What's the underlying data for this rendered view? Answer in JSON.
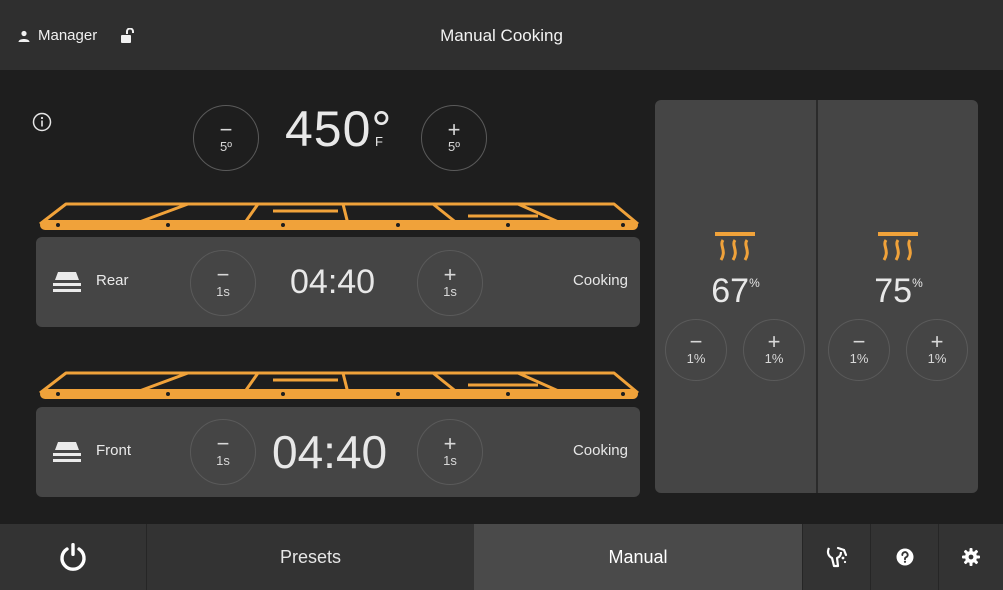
{
  "header": {
    "user_name": "Manager",
    "title": "Manual Cooking"
  },
  "temperature": {
    "value": "450°",
    "unit": "F",
    "step_down": "5º",
    "step_up": "5º"
  },
  "zones": [
    {
      "name": "Rear",
      "time": "04:40",
      "status": "Cooking",
      "step_down": "1s",
      "step_up": "1s"
    },
    {
      "name": "Front",
      "time": "04:40",
      "status": "Cooking",
      "step_down": "1s",
      "step_up": "1s"
    }
  ],
  "heaters": [
    {
      "value": "67",
      "unit": "%",
      "step_down": "1%",
      "step_up": "1%"
    },
    {
      "value": "75",
      "unit": "%",
      "step_down": "1%",
      "step_up": "1%"
    }
  ],
  "footer": {
    "presets_label": "Presets",
    "manual_label": "Manual"
  },
  "colors": {
    "accent": "#f0a23a",
    "background": "#1e1e1e",
    "panel": "#454545",
    "header": "#2f2f2f"
  },
  "icons": {
    "user": "user-icon",
    "lock": "unlock-icon",
    "info": "info-icon",
    "zone": "rack-icon",
    "heater": "heater-icon",
    "power": "power-icon",
    "cleaning": "cleaning-icon",
    "help": "help-icon",
    "settings": "gear-icon"
  }
}
